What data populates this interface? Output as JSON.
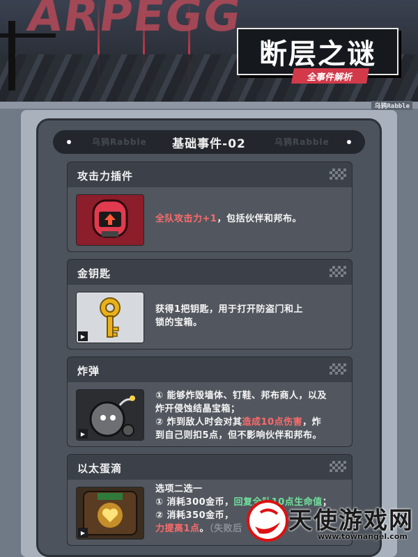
{
  "banner": {
    "bg_word": "ARPEGG",
    "title": "断层之谜",
    "subtitle": "全事件解析",
    "strip_tag": "乌鸦Rabble"
  },
  "section": {
    "header_title": "基础事件-02",
    "watermark_left": "乌鸦Rabble",
    "watermark_right": "乌鸦Rabble"
  },
  "cards": [
    {
      "title": "攻击力插件",
      "lines": [
        [
          {
            "t": "全队攻击力+1",
            "c": "red"
          },
          {
            "t": "，包括伙伴和邦布。",
            "c": ""
          }
        ]
      ]
    },
    {
      "title": "金钥匙",
      "lines": [
        [
          {
            "t": "获得1把钥匙，用于打开防盗门和上",
            "c": ""
          }
        ],
        [
          {
            "t": "锁的宝箱。",
            "c": ""
          }
        ]
      ]
    },
    {
      "title": "炸弹",
      "lines": [
        [
          {
            "t": "① 能够炸毁墙体、钉鞋、邦布商人，以及",
            "c": ""
          }
        ],
        [
          {
            "t": "炸开侵蚀结晶宝箱；",
            "c": ""
          }
        ],
        [
          {
            "t": "② 炸到敌人时会对其",
            "c": ""
          },
          {
            "t": "造成10点伤害",
            "c": "red"
          },
          {
            "t": "，炸",
            "c": ""
          }
        ],
        [
          {
            "t": "到自己则扣5点，但不影响伙伴和邦布。",
            "c": ""
          }
        ]
      ]
    },
    {
      "title": "以太蛋滴",
      "lines": [
        [
          {
            "t": "选项二选一",
            "c": ""
          }
        ],
        [
          {
            "t": "① 消耗300金币，",
            "c": ""
          },
          {
            "t": "回复全队10点生命值",
            "c": "green"
          },
          {
            "t": "；",
            "c": ""
          }
        ],
        [
          {
            "t": "② 消耗350金币，",
            "c": ""
          }
        ],
        [
          {
            "t": "力提高1点",
            "c": "red"
          },
          {
            "t": "。",
            "c": ""
          },
          {
            "t": "（失败后",
            "c": "gray"
          }
        ]
      ]
    }
  ],
  "watermark": {
    "brand": "天使游戏网",
    "url": "www.townangel.com"
  },
  "colors": {
    "accent_red": "#d23a4a",
    "highlight_red": "#ff6b6b",
    "highlight_green": "#6fe39b",
    "panel": "#4d535c"
  }
}
